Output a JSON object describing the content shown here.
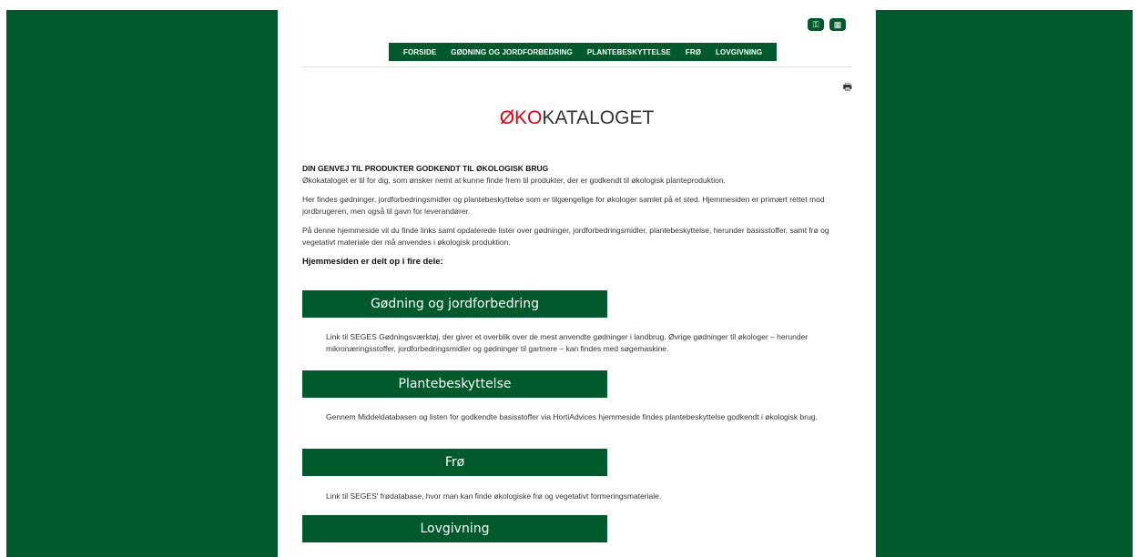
{
  "colors": {
    "brand_green": "#005a2b",
    "accent_red": "#e3000f"
  },
  "header": {
    "icons": [
      "key-icon",
      "calculator-icon"
    ],
    "nav": [
      "FORSIDE",
      "GØDNING OG JORDFORBEDRING",
      "PLANTEBESKYTTELSE",
      "FRØ",
      "LOVGIVNING"
    ]
  },
  "title": {
    "accent": "ØKO",
    "rest": "KATALOGET"
  },
  "intro": {
    "heading": "DIN GENVEJ TIL PRODUKTER GODKENDT TIL ØKOLOGISK BRUG",
    "p1": "Økokataloget er til for dig, som ønsker nemt at kunne finde frem til produkter, der er godkendt til økologisk planteproduktion.",
    "p2": "Her findes gødninger, jordforbedringsmidler og plantebeskyttelse som er tilgængelige for økologer samlet på et sted. Hjemmesiden er primært rettet mod jordbrugeren, men også til gavn for leverandører.",
    "p3": "På denne hjemmeside vil du finde links samt opdaterede lister over gødninger, jordforbedringsmidler, plantebeskyttelse, herunder basisstoffer, samt frø og vegetativt materiale der må anvendes i økologisk produktion.",
    "parts_heading": "Hjemmesiden er delt op i fire dele:"
  },
  "sections": [
    {
      "label": "Gødning og jordforbedring",
      "desc": "Link til SEGES Gødningsværktøj, der giver et overblik over de mest anvendte gødninger i landbrug. Øvrige gødninger til økologer – herunder mikronæringsstoffer, jordforbedringsmidler og gødninger til gartnere – kan findes med søgemaskine."
    },
    {
      "label": "Plantebeskyttelse",
      "desc": "Gennem Middeldatabasen og listen for godkendte basisstoffer via HortiAdvices hjemmeside findes plantebeskyttelse godkendt i økologisk brug."
    },
    {
      "label": "Frø",
      "desc": "Link til SEGES' frødatabase, hvor man kan finde økologiske frø og vegetativt formeringsmateriale."
    },
    {
      "label": "Lovgivning",
      "desc": ""
    }
  ]
}
